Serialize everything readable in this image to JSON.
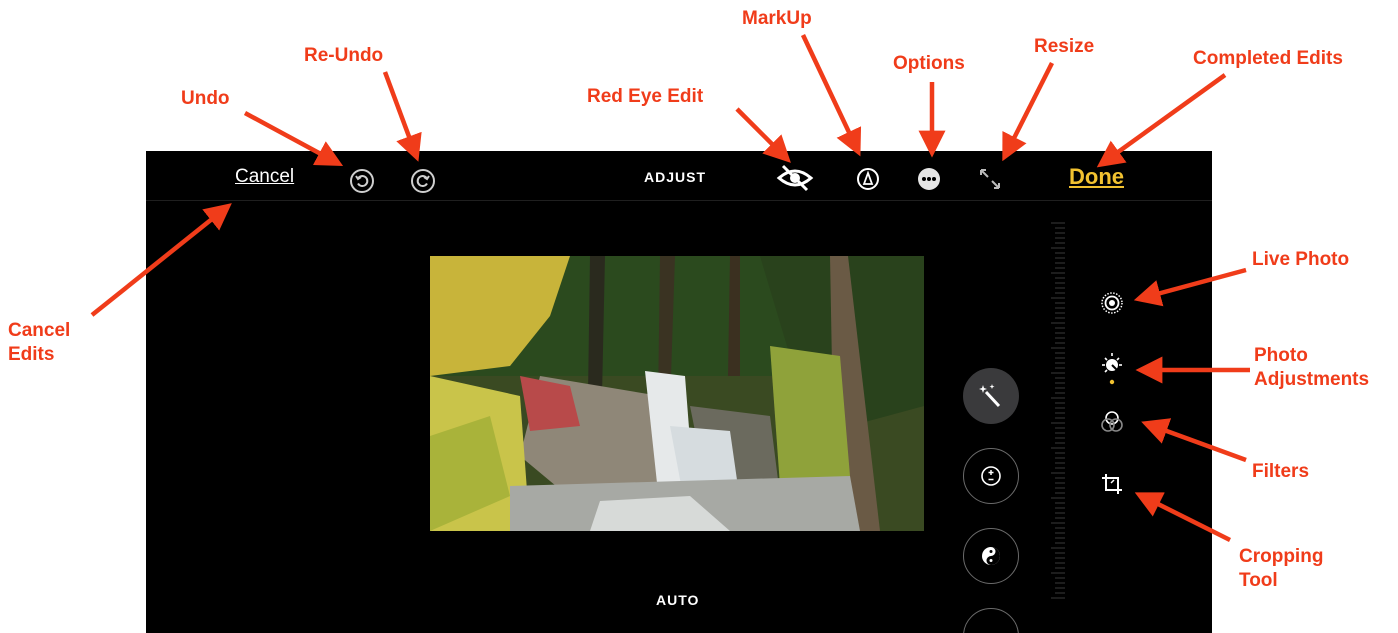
{
  "annotations": {
    "undo": "Undo",
    "re_undo": "Re-Undo",
    "red_eye": "Red Eye Edit",
    "markup": "MarkUp",
    "options": "Options",
    "resize": "Resize",
    "completed": "Completed Edits",
    "cancel_edits": "Cancel Edits",
    "live_photo": "Live Photo",
    "photo_adjustments": "Photo Adjustments",
    "filters": "Filters",
    "cropping": "Cropping Tool"
  },
  "toolbar": {
    "cancel_label": "Cancel",
    "mode_label": "ADJUST",
    "done_label": "Done",
    "icons": [
      "undo-icon",
      "redo-icon",
      "red-eye-icon",
      "markup-icon",
      "options-icon",
      "resize-icon"
    ]
  },
  "adjust": {
    "current_tool_label": "AUTO",
    "tools": [
      "auto-enhance-icon",
      "exposure-icon",
      "brilliance-icon"
    ]
  },
  "sidebar": {
    "items": [
      "live-photo-icon",
      "adjust-icon",
      "filters-icon",
      "crop-icon"
    ]
  },
  "colors": {
    "annotation": "#f03c1a",
    "done": "#f2c230",
    "background": "#000000"
  }
}
